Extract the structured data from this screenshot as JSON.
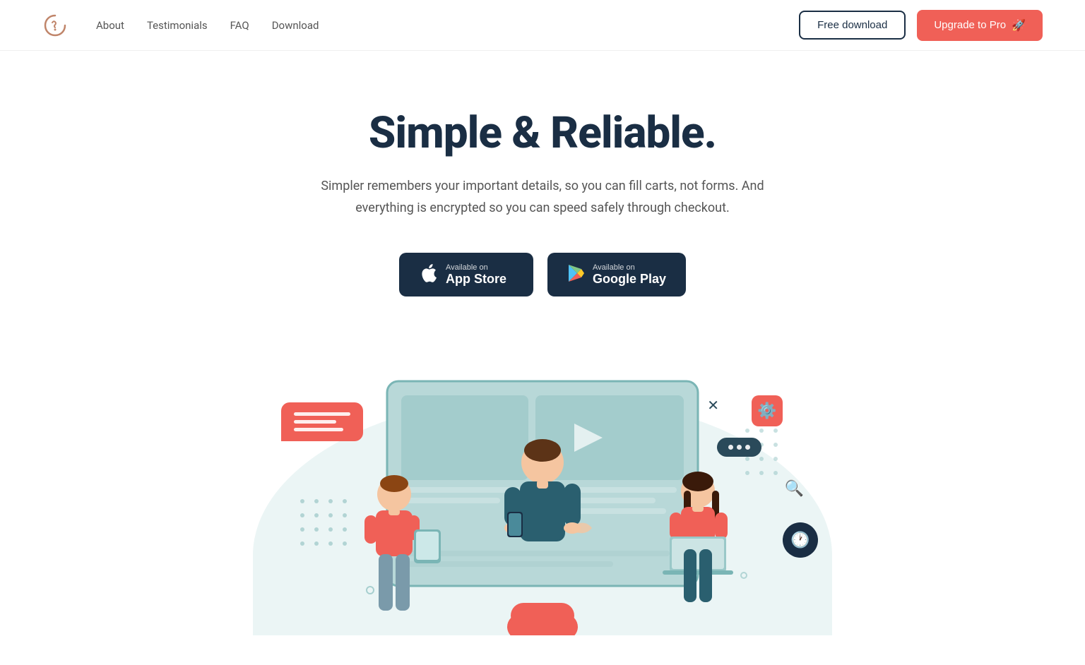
{
  "nav": {
    "logo_alt": "Simpler logo",
    "links": [
      {
        "label": "About",
        "href": "#about"
      },
      {
        "label": "Testimonials",
        "href": "#testimonials"
      },
      {
        "label": "FAQ",
        "href": "#faq"
      },
      {
        "label": "Download",
        "href": "#download"
      }
    ],
    "free_download_label": "Free download",
    "upgrade_label": "Upgrade to Pro",
    "upgrade_icon": "🚀"
  },
  "hero": {
    "title": "Simple & Reliable.",
    "subtitle": "Simpler remembers your important details, so you can fill carts, not forms. And everything is encrypted so you can speed safely through checkout.",
    "app_store": {
      "available_on": "Available on",
      "name": "App Store"
    },
    "google_play": {
      "available_on": "Available on",
      "name": "Google Play"
    }
  },
  "illustration": {
    "alt": "App illustration showing people interacting with a digital interface"
  },
  "colors": {
    "dark_navy": "#1a2e44",
    "coral": "#f06057",
    "teal_light": "#b8d8d8",
    "teal_mid": "#2a5f6f"
  }
}
